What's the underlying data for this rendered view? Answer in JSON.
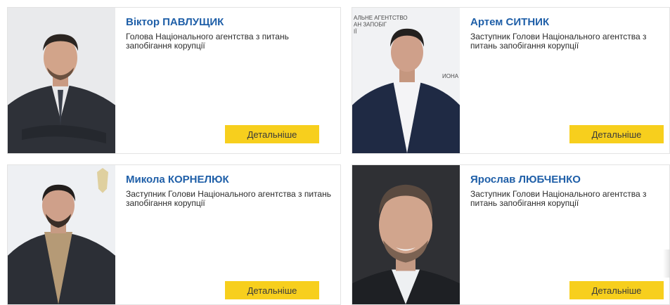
{
  "people": [
    {
      "name": "Віктор ПАВЛУЩИК",
      "position": "Голова Національного агентства з питань запобігання корупції",
      "button_label": "Детальніше"
    },
    {
      "name": "Артем СИТНИК",
      "position": "Заступник Голови Національного агентства з питань запобігання корупції",
      "button_label": "Детальніше",
      "photo_backdrop_text": [
        "АЛЬНЕ АГЕНТСТВО",
        "АН ЗАПОБІГ",
        "ІЇ",
        "ИОНА"
      ]
    },
    {
      "name": "Микола КОРНЕЛЮК",
      "position": "Заступник Голови Національного агентства з питань запобігання корупції",
      "button_label": "Детальніше"
    },
    {
      "name": "Ярослав ЛЮБЧЕНКО",
      "position": "Заступник Голови Національного агентства з питань запобігання корупції",
      "button_label": "Детальніше"
    }
  ],
  "colors": {
    "name_blue": "#1f5fa8",
    "button_yellow": "#f7cf1d",
    "border": "#e3e3e3"
  }
}
